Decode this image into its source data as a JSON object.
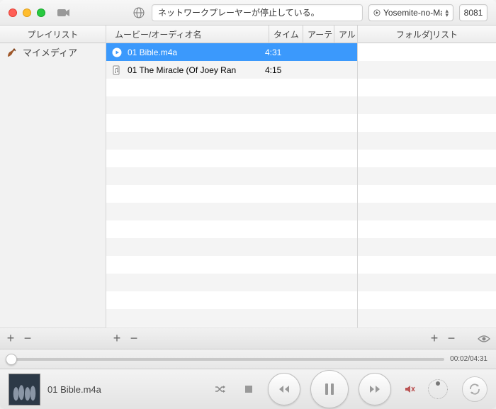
{
  "toolbar": {
    "status": "ネットワークプレーヤーが停止している。",
    "device": "Yosemite-no-MacB",
    "port": "8081"
  },
  "columns": {
    "playlist": "プレイリスト",
    "folder": "フォルダ]リスト",
    "media_name": "ムービー/オーディオ名",
    "time": "タイム",
    "artist": "アーテ",
    "album": "アル"
  },
  "playlists": [
    {
      "icon": "violin",
      "label": "マイメディア"
    }
  ],
  "tracks": [
    {
      "icon": "play",
      "name": "01 Bible.m4a",
      "time": "4:31",
      "selected": true
    },
    {
      "icon": "audio",
      "name": "01 The Miracle (Of Joey Ran",
      "time": "4:15",
      "selected": false
    }
  ],
  "progress": {
    "elapsed": "00:02",
    "total": "04:31"
  },
  "now_playing": {
    "title": "01 Bible.m4a"
  }
}
